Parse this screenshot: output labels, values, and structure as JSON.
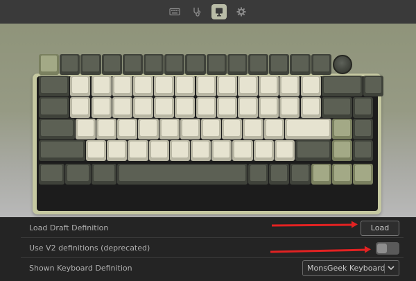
{
  "topbar": {
    "icons": [
      {
        "name": "keyboard-icon",
        "active": false
      },
      {
        "name": "stethoscope-icon",
        "active": false
      },
      {
        "name": "configure-icon",
        "active": true
      },
      {
        "name": "gear-icon",
        "active": false
      }
    ]
  },
  "keyboard": {
    "rows": [
      [
        "green",
        "dark",
        "dark",
        "dark",
        "dark",
        "dark",
        "dark",
        "dark",
        "dark",
        "dark",
        "dark",
        "dark",
        "dark",
        "dark",
        "knob"
      ],
      [
        "dark",
        "cream",
        "cream",
        "cream",
        "cream",
        "cream",
        "cream",
        "cream",
        "cream",
        "cream",
        "cream",
        "cream",
        "cream",
        "dark",
        "dark"
      ],
      [
        "dark",
        "cream",
        "cream",
        "cream",
        "cream",
        "cream",
        "cream",
        "cream",
        "cream",
        "cream",
        "cream",
        "cream",
        "cream",
        "dark",
        "dark"
      ],
      [
        "dark",
        "cream",
        "cream",
        "cream",
        "cream",
        "cream",
        "cream",
        "cream",
        "cream",
        "cream",
        "cream",
        "cream",
        "green",
        "dark"
      ],
      [
        "dark",
        "cream",
        "cream",
        "cream",
        "cream",
        "cream",
        "cream",
        "cream",
        "cream",
        "cream",
        "cream",
        "dark",
        "green",
        "dark"
      ],
      [
        "dark",
        "dark",
        "dark",
        "dark",
        "dark",
        "dark",
        "dark",
        "green",
        "green",
        "green"
      ]
    ]
  },
  "settings": {
    "load_draft_label": "Load Draft Definition",
    "load_button": "Load",
    "v2_label": "Use V2 definitions (deprecated)",
    "v2_enabled": false,
    "shown_def_label": "Shown Keyboard Definition",
    "shown_def_value": "MonsGeek Keyboard"
  },
  "colors": {
    "arrow": "#e32222",
    "case": "#c5c8a1",
    "accent_active": "#b9bca7"
  }
}
